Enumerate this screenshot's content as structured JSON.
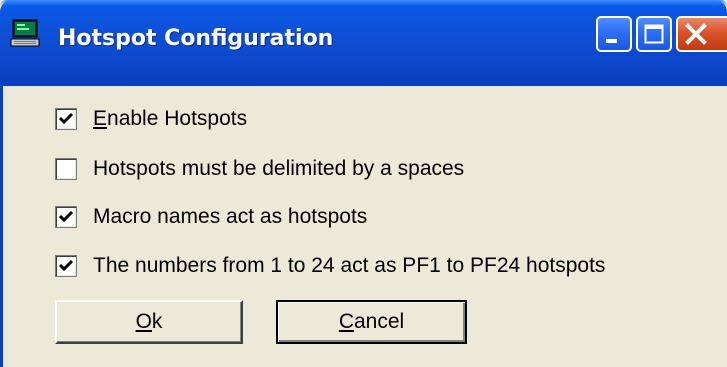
{
  "window": {
    "title": "Hotspot Configuration",
    "icon": "terminal-computer-icon",
    "controls": {
      "minimize_icon": "minimize-icon",
      "maximize_icon": "maximize-icon",
      "close_icon": "close-icon"
    }
  },
  "options": [
    {
      "accel": "E",
      "label_rest": "nable Hotspots",
      "checked": true
    },
    {
      "accel": "",
      "label_rest": "Hotspots must be delimited by a spaces",
      "checked": false
    },
    {
      "accel": "",
      "label_rest": "Macro names act as hotspots",
      "checked": true
    },
    {
      "accel": "",
      "label_rest": "The numbers from 1 to 24 act as PF1 to PF24 hotspots",
      "checked": true
    }
  ],
  "buttons": {
    "ok": {
      "accel": "O",
      "rest": "k"
    },
    "cancel": {
      "accel": "C",
      "rest": "ancel"
    }
  },
  "colors": {
    "titlebar": "#0c47cc",
    "dialog_bg": "#ece9d8",
    "close_button": "#d9532a"
  }
}
